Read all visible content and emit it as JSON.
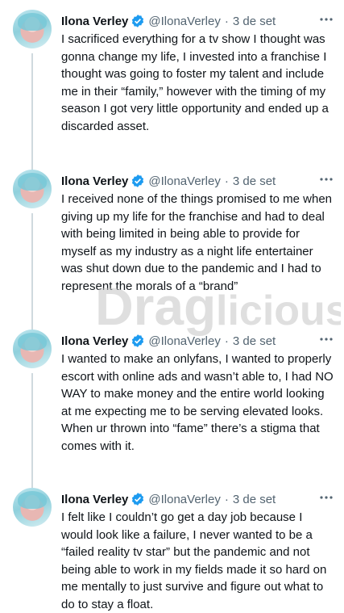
{
  "account": {
    "display_name": "Ilona Verley",
    "handle": "@IlonaVerley",
    "separator": "·",
    "date": "3 de set"
  },
  "icons": {
    "verified": "verified-badge-icon",
    "more": "more-options-icon",
    "avatar": "profile-avatar"
  },
  "colors": {
    "verified_blue": "#1d9bf0",
    "text": "#0f1419",
    "secondary": "#536471",
    "thread_line": "#cfd9de"
  },
  "tweets": [
    {
      "text": "I sacrificed everything for a tv show I thought was gonna change my life, I invested into a franchise I thought was going to foster my talent and include me in their “family,” however with the timing of my season I got very little opportunity and ended up a discarded asset."
    },
    {
      "text": "I received none of the things promised to me when giving up my life for the franchise and had to deal with being limited in being able to provide for myself as my industry as a night life entertainer was shut down due to the pandemic and I had to represent the morals of a “brand”"
    },
    {
      "text": "I wanted to make an onlyfans, I wanted to properly escort with online ads and wasn’t able to, I had NO WAY to make money and the entire world looking at me expecting me to be serving elevated looks. When ur thrown into “fame” there’s a stigma that comes with it."
    },
    {
      "text": "I felt like I couldn’t go get a day job because I would look like a failure, I never wanted to be a “failed reality tv star” but the pandemic and not being able to work in my fields made it so hard on me mentally to just survive and figure out what to do to stay a float."
    }
  ],
  "watermark": {
    "part1": "Drag",
    "part2": "licious"
  }
}
